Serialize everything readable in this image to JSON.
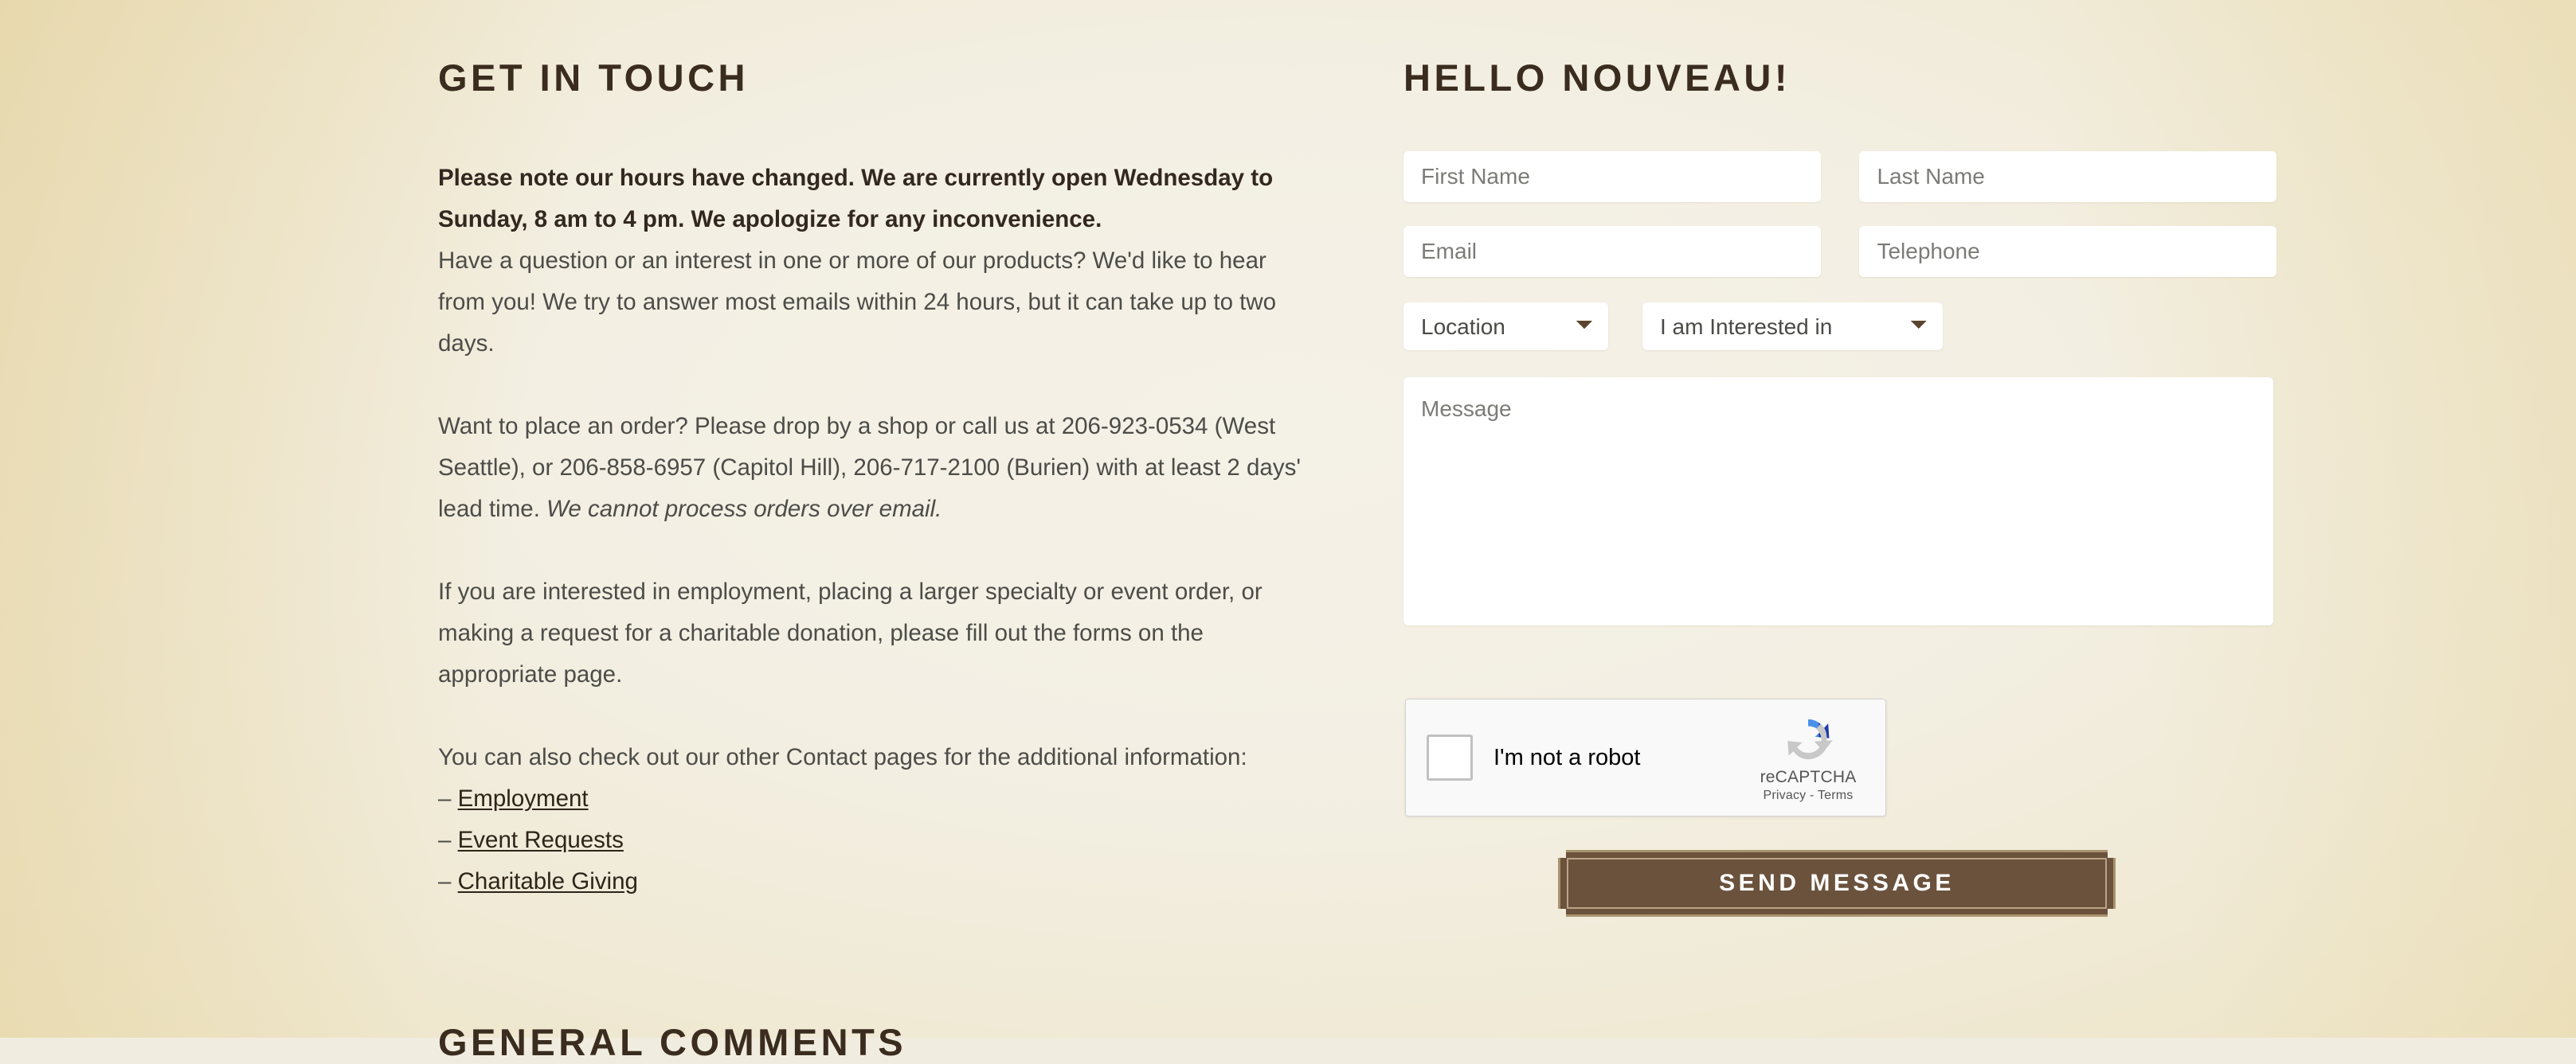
{
  "background": {
    "center_color": "#f3efe3",
    "edge_color": "#e7d7a4"
  },
  "left": {
    "heading": "GET IN TOUCH",
    "notice": "Please note our hours have changed.  We are currently open Wednesday to Sunday, 8 am to 4 pm.  We apologize for any inconvenience.",
    "paragraph_question": "Have a question or an interest in one or more of our products?  We'd like to hear from you! We try to answer most emails within 24 hours, but it can take up to two days.",
    "paragraph_order_prefix": "Want to place an order?  Please drop by a shop or call us at 206-923-0534 (West Seattle), or 206-858-6957 (Capitol Hill), 206-717-2100 (Burien) with at least 2 days' lead time.  ",
    "paragraph_order_italic": "We cannot process orders over email.",
    "paragraph_forms": "If you are interested in employment, placing a larger specialty or event order, or making a request for a charitable donation, please fill out the forms on the appropriate page.",
    "links_intro": "You can also check out our other Contact pages for the additional information:",
    "link_dash": "–",
    "links": [
      {
        "label": "Employment"
      },
      {
        "label": "Event Requests"
      },
      {
        "label": "Charitable Giving"
      }
    ],
    "next_section_heading": "GENERAL COMMENTS"
  },
  "form": {
    "heading": "HELLO NOUVEAU!",
    "first_name": {
      "placeholder": "First Name",
      "value": ""
    },
    "last_name": {
      "placeholder": "Last Name",
      "value": ""
    },
    "email": {
      "placeholder": "Email",
      "value": ""
    },
    "telephone": {
      "placeholder": "Telephone",
      "value": ""
    },
    "location": {
      "selected": "Location"
    },
    "interest": {
      "selected": "I am Interested in"
    },
    "message": {
      "placeholder": "Message",
      "value": ""
    },
    "submit_label": "SEND MESSAGE",
    "submit_bg": "#6b523c",
    "submit_border": "#a8936f"
  },
  "recaptcha": {
    "checkbox_label": "I'm not a robot",
    "brand": "reCAPTCHA",
    "terms": "Privacy - Terms"
  }
}
